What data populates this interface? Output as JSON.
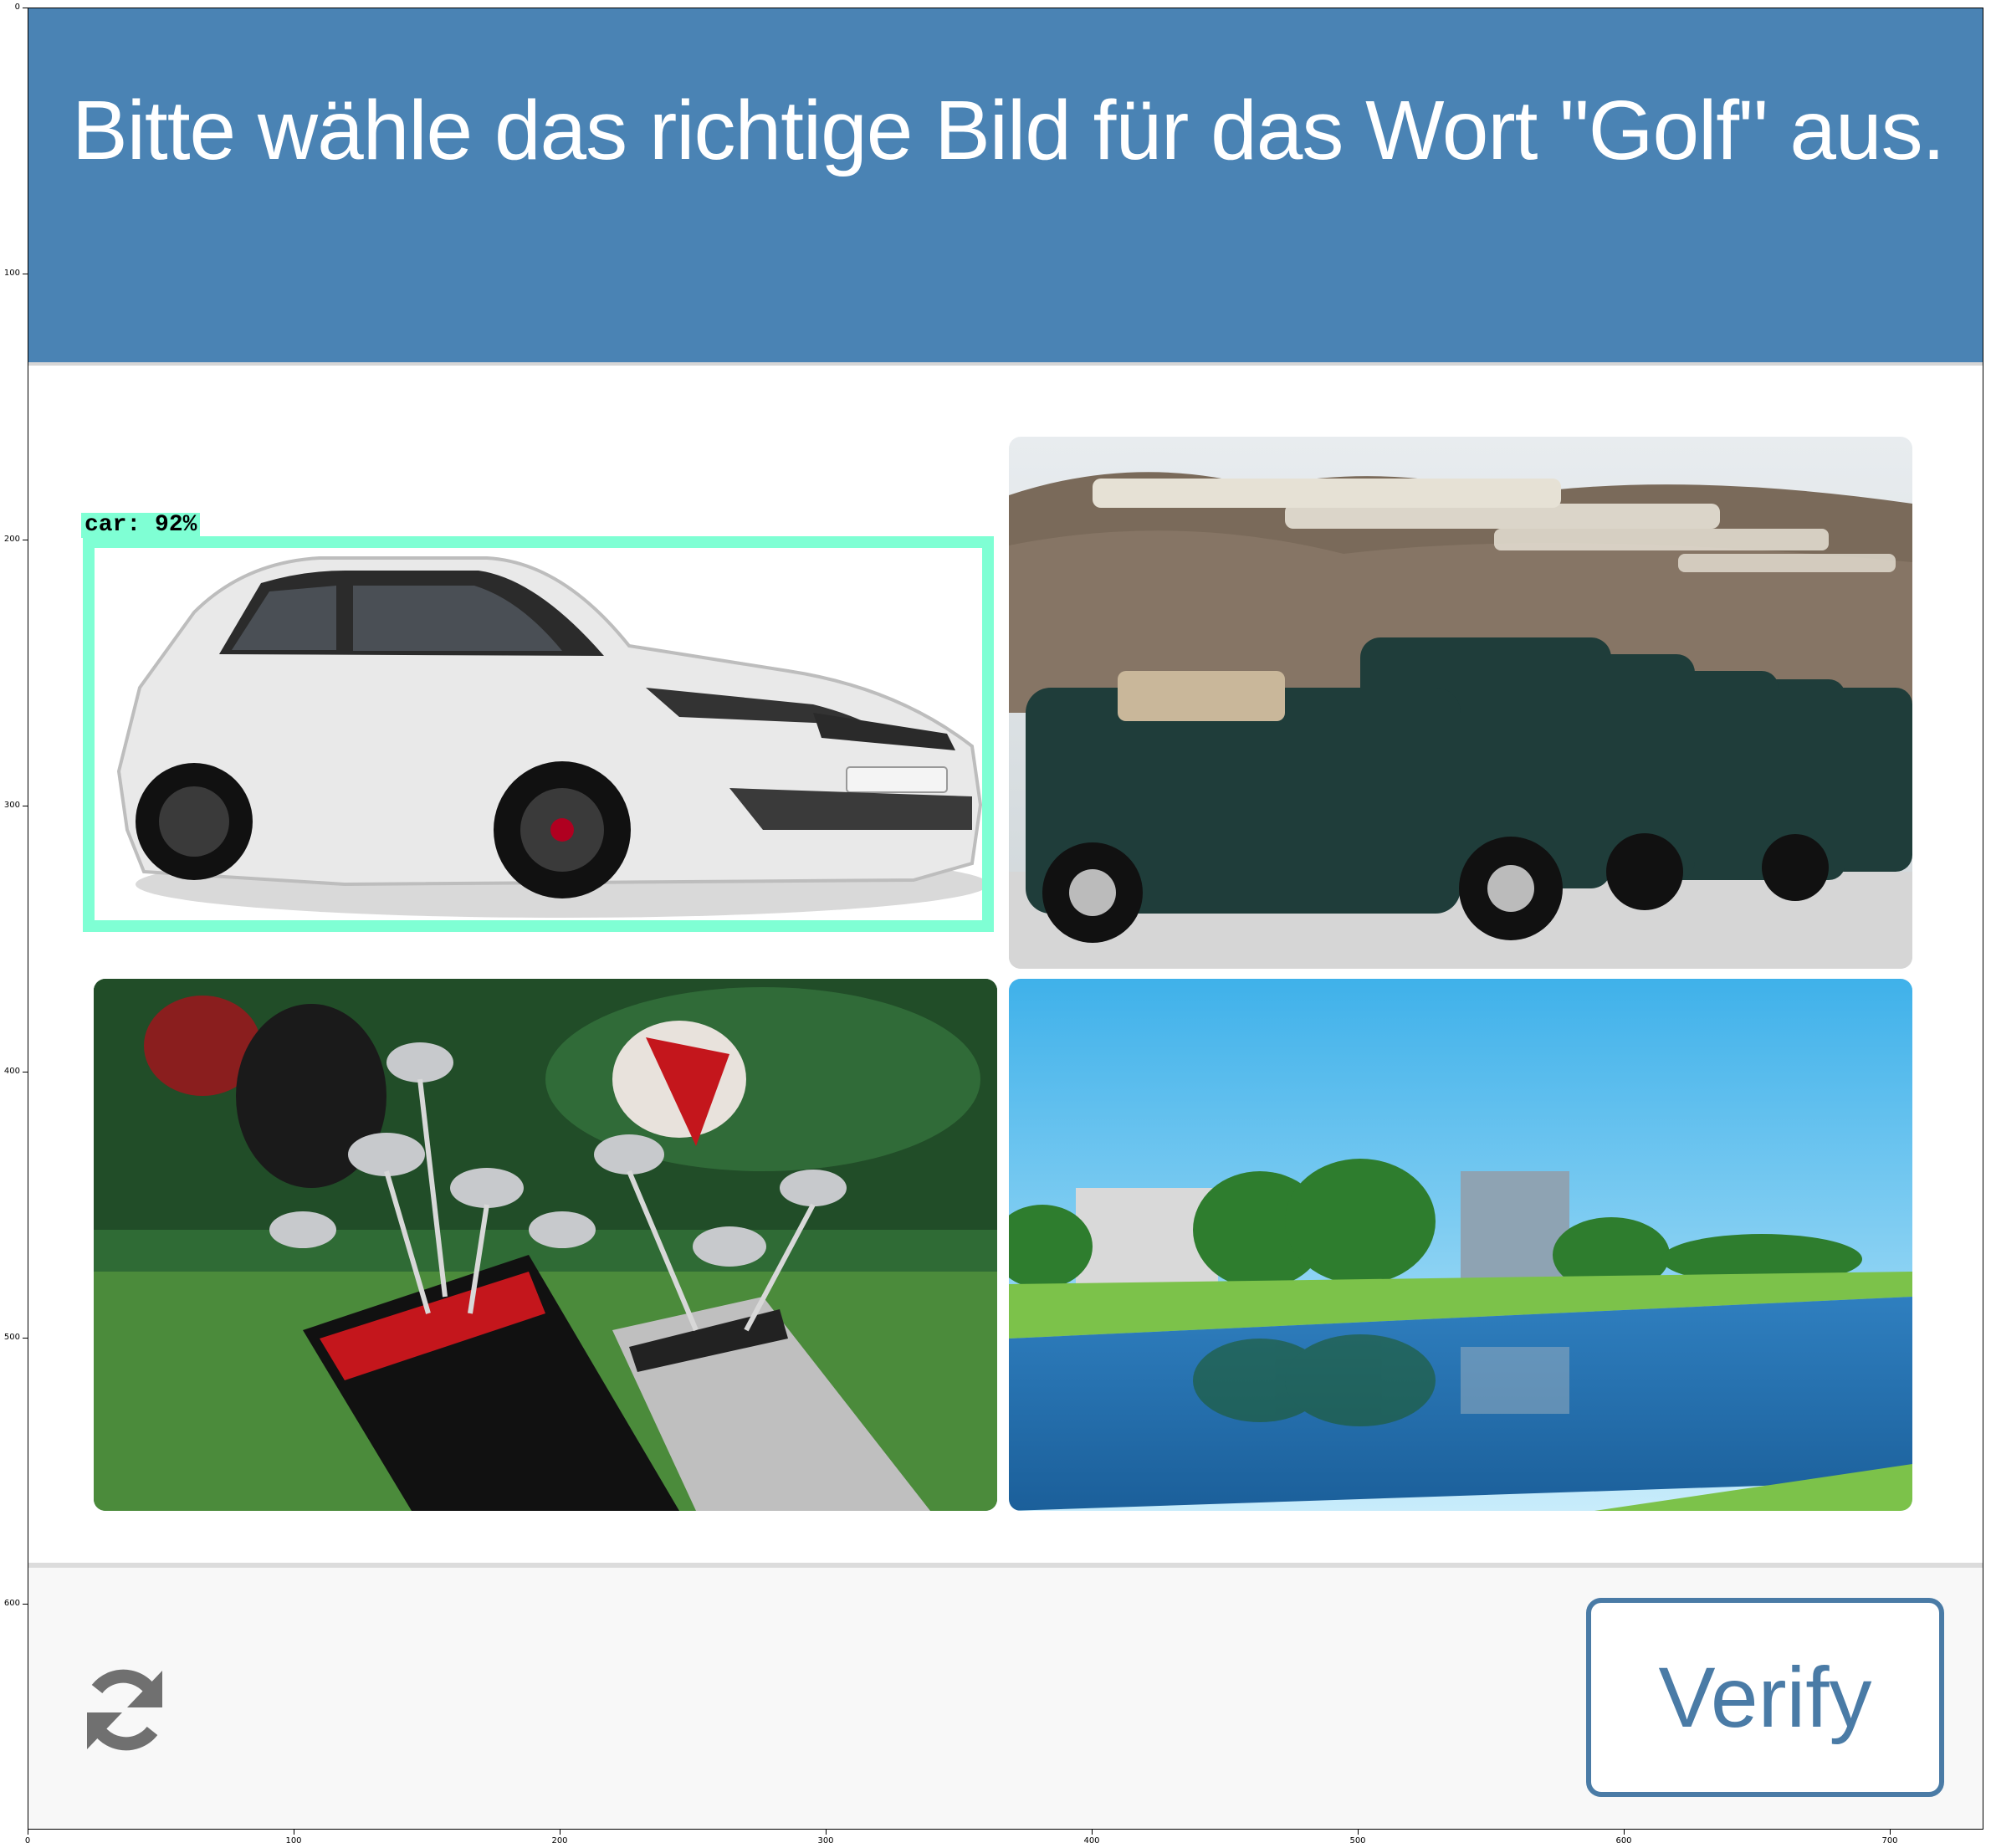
{
  "captcha": {
    "instruction": "Bitte wähle das richtige Bild für das Wort \"Golf\" aus.",
    "tiles": [
      {
        "subject": "white hatchback car"
      },
      {
        "subject": "row of golf carts"
      },
      {
        "subject": "golf bags with clubs"
      },
      {
        "subject": "golf course lake"
      }
    ],
    "detection": {
      "label": "car:  92%"
    },
    "refresh_icon": "refresh-icon",
    "verify_label": "Verify"
  },
  "plot_axes": {
    "x_ticks": [
      "0",
      "100",
      "200",
      "300",
      "400",
      "500",
      "600",
      "700"
    ],
    "y_ticks": [
      "0",
      "100",
      "200",
      "300",
      "400",
      "500",
      "600"
    ]
  },
  "colors": {
    "header_bg": "#4a83b4",
    "detection_box": "#7fffd4",
    "verify_border": "#4a7ba6",
    "footer_bg": "#f8f8f8"
  }
}
